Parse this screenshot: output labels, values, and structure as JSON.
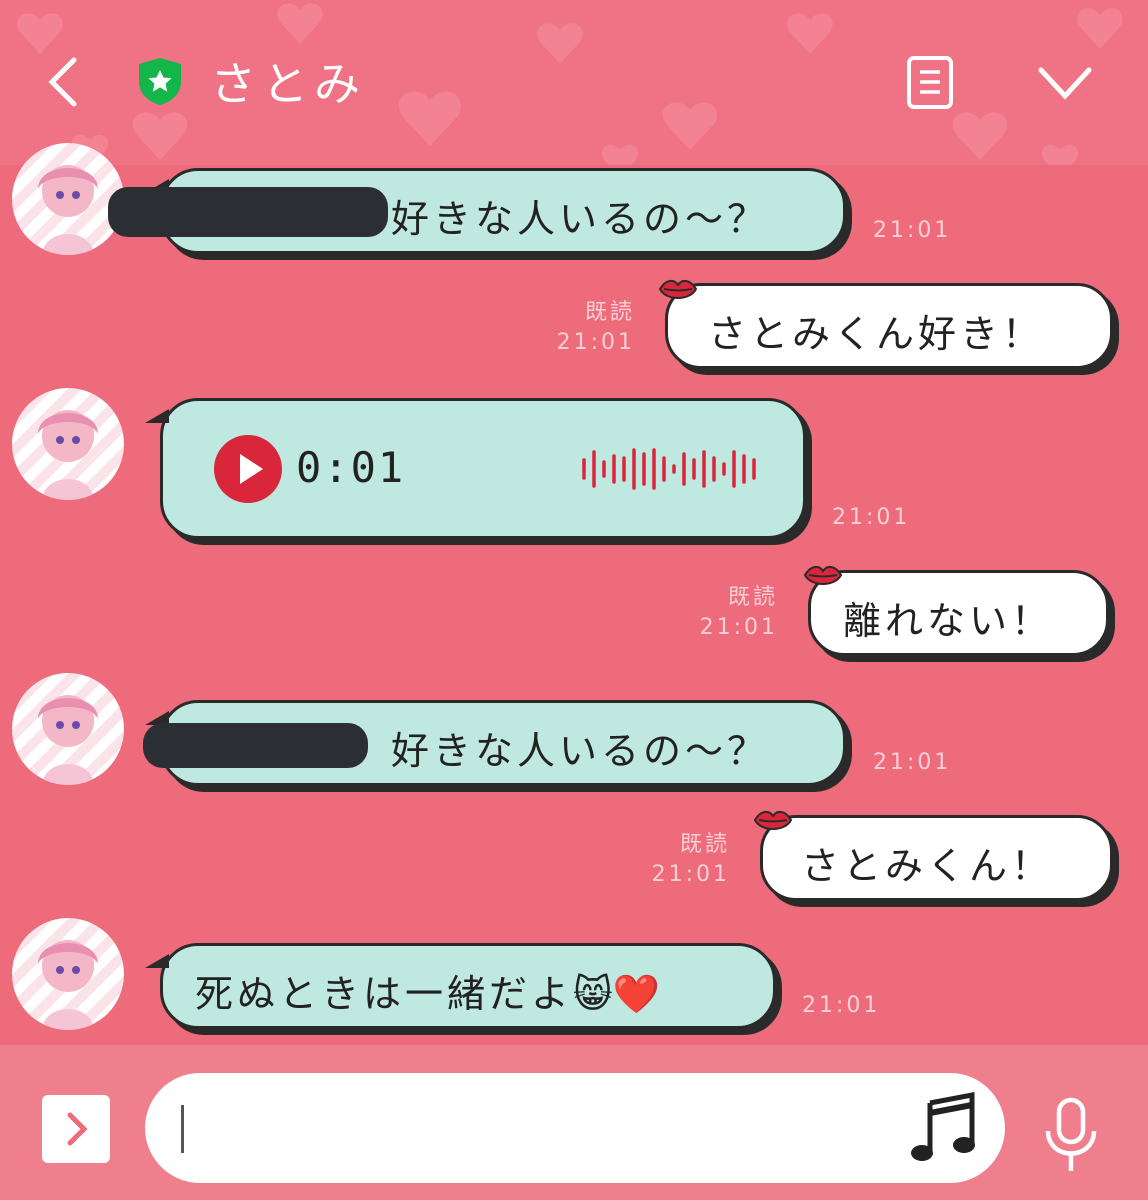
{
  "header": {
    "title": "さとみ"
  },
  "messages": {
    "m1": {
      "text": "好きな人いるの～？",
      "time": "21:01"
    },
    "m2": {
      "read": "既読",
      "time": "21:01",
      "text": "さとみくん好き！"
    },
    "m3": {
      "duration": "0:01",
      "time": "21:01"
    },
    "m4": {
      "read": "既読",
      "time": "21:01",
      "text": "離れない！"
    },
    "m5": {
      "text": "好きな人いるの～？",
      "time": "21:01"
    },
    "m6": {
      "read": "既読",
      "time": "21:01",
      "text": "さとみくん！"
    },
    "m7": {
      "text": "死ぬときは一緒だよ",
      "emoji": "😸❤️",
      "time": "21:01"
    }
  },
  "colors": {
    "background": "#ee6b7b",
    "incoming_bubble": "#bfe8e0",
    "outgoing_bubble": "#ffffff",
    "accent_red": "#d9263a"
  },
  "icons": [
    "back-icon",
    "verified-shield-icon",
    "notes-icon",
    "chevron-down-icon",
    "play-icon",
    "waveform-icon",
    "lips-icon",
    "expand-icon",
    "music-note-icon",
    "microphone-icon"
  ]
}
